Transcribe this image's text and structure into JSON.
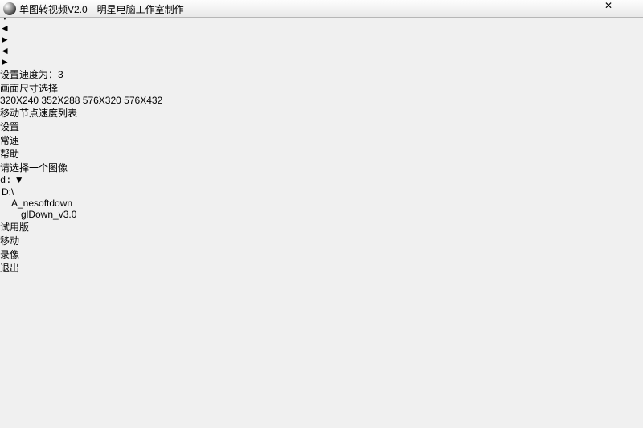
{
  "window": {
    "title": "单图转视频V2.0　明星电脑工作室制作",
    "close_glyph": "✕"
  },
  "speed": {
    "slider_left_glyph": "◄",
    "slider_right_glyph": "►",
    "label": "设置速度为：3"
  },
  "size_section": {
    "title": "画面尺寸选择",
    "opt1": "320X240",
    "opt2": "352X288",
    "opt3": "576X320",
    "opt4": "576X432"
  },
  "vlist_label": "移动节点速度列表",
  "mid_buttons": {
    "settings": "设置",
    "normal_speed": "常速",
    "help": "帮助"
  },
  "right": {
    "prompt": "请选择一个图像",
    "drive_text": "d:",
    "drive_arrow": "▼",
    "tree": {
      "root": "D:\\",
      "sel": "A_nesoftdown",
      "child": "glDown_v3.0"
    },
    "trial": "试用版",
    "buttons": {
      "move": "移动",
      "record": "录像",
      "exit": "退出"
    }
  },
  "scroll": {
    "up": "▲",
    "down": "▼",
    "left": "◄",
    "right": "►"
  }
}
